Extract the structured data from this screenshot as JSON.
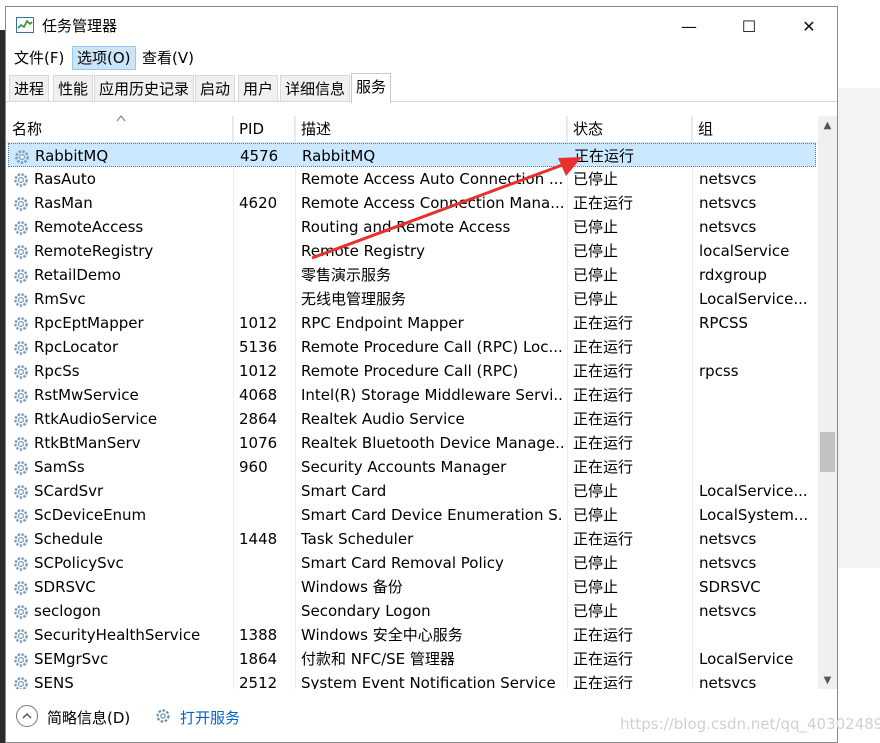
{
  "window": {
    "title": "任务管理器",
    "minimize": "—",
    "maximize": "☐",
    "close": "✕"
  },
  "menubar": [
    "文件(F)",
    "选项(O)",
    "查看(V)"
  ],
  "tabs": [
    "进程",
    "性能",
    "应用历史记录",
    "启动",
    "用户",
    "详细信息",
    "服务"
  ],
  "columns": {
    "name": "名称",
    "pid": "PID",
    "desc": "描述",
    "status": "状态",
    "group": "组"
  },
  "services": [
    {
      "name": "RabbitMQ",
      "pid": "4576",
      "desc": "RabbitMQ",
      "status": "正在运行",
      "group": ""
    },
    {
      "name": "RasAuto",
      "pid": "",
      "desc": "Remote Access Auto Connection ...",
      "status": "已停止",
      "group": "netsvcs"
    },
    {
      "name": "RasMan",
      "pid": "4620",
      "desc": "Remote Access Connection Mana...",
      "status": "正在运行",
      "group": "netsvcs"
    },
    {
      "name": "RemoteAccess",
      "pid": "",
      "desc": "Routing and Remote Access",
      "status": "已停止",
      "group": "netsvcs"
    },
    {
      "name": "RemoteRegistry",
      "pid": "",
      "desc": "Remote Registry",
      "status": "已停止",
      "group": "localService"
    },
    {
      "name": "RetailDemo",
      "pid": "",
      "desc": "零售演示服务",
      "status": "已停止",
      "group": "rdxgroup"
    },
    {
      "name": "RmSvc",
      "pid": "",
      "desc": "无线电管理服务",
      "status": "已停止",
      "group": "LocalService..."
    },
    {
      "name": "RpcEptMapper",
      "pid": "1012",
      "desc": "RPC Endpoint Mapper",
      "status": "正在运行",
      "group": "RPCSS"
    },
    {
      "name": "RpcLocator",
      "pid": "5136",
      "desc": "Remote Procedure Call (RPC) Loc...",
      "status": "正在运行",
      "group": ""
    },
    {
      "name": "RpcSs",
      "pid": "1012",
      "desc": "Remote Procedure Call (RPC)",
      "status": "正在运行",
      "group": "rpcss"
    },
    {
      "name": "RstMwService",
      "pid": "4068",
      "desc": "Intel(R) Storage Middleware Servi...",
      "status": "正在运行",
      "group": ""
    },
    {
      "name": "RtkAudioService",
      "pid": "2864",
      "desc": "Realtek Audio Service",
      "status": "正在运行",
      "group": ""
    },
    {
      "name": "RtkBtManServ",
      "pid": "1076",
      "desc": "Realtek Bluetooth Device Manage...",
      "status": "正在运行",
      "group": ""
    },
    {
      "name": "SamSs",
      "pid": "960",
      "desc": "Security Accounts Manager",
      "status": "正在运行",
      "group": ""
    },
    {
      "name": "SCardSvr",
      "pid": "",
      "desc": "Smart Card",
      "status": "已停止",
      "group": "LocalService..."
    },
    {
      "name": "ScDeviceEnum",
      "pid": "",
      "desc": "Smart Card Device Enumeration S...",
      "status": "已停止",
      "group": "LocalSystem..."
    },
    {
      "name": "Schedule",
      "pid": "1448",
      "desc": "Task Scheduler",
      "status": "正在运行",
      "group": "netsvcs"
    },
    {
      "name": "SCPolicySvc",
      "pid": "",
      "desc": "Smart Card Removal Policy",
      "status": "已停止",
      "group": "netsvcs"
    },
    {
      "name": "SDRSVC",
      "pid": "",
      "desc": "Windows 备份",
      "status": "已停止",
      "group": "SDRSVC"
    },
    {
      "name": "seclogon",
      "pid": "",
      "desc": "Secondary Logon",
      "status": "已停止",
      "group": "netsvcs"
    },
    {
      "name": "SecurityHealthService",
      "pid": "1388",
      "desc": "Windows 安全中心服务",
      "status": "正在运行",
      "group": ""
    },
    {
      "name": "SEMgrSvc",
      "pid": "1864",
      "desc": "付款和 NFC/SE 管理器",
      "status": "正在运行",
      "group": "LocalService"
    },
    {
      "name": "SENS",
      "pid": "2512",
      "desc": "System Event Notification Service",
      "status": "正在运行",
      "group": "netsvcs"
    }
  ],
  "footer": {
    "fewer_details": "简略信息(D)",
    "open_services": "打开服务"
  },
  "watermark": "https://blog.csdn.net/qq_40302489",
  "colors": {
    "selection": "#cce8ff",
    "link": "#0066cc",
    "annotation_arrow": "#e8302f"
  },
  "icons": {
    "app": "task-manager-icon",
    "service": "gear-icon",
    "fewer": "chevron-up-icon",
    "open": "services-icon"
  }
}
